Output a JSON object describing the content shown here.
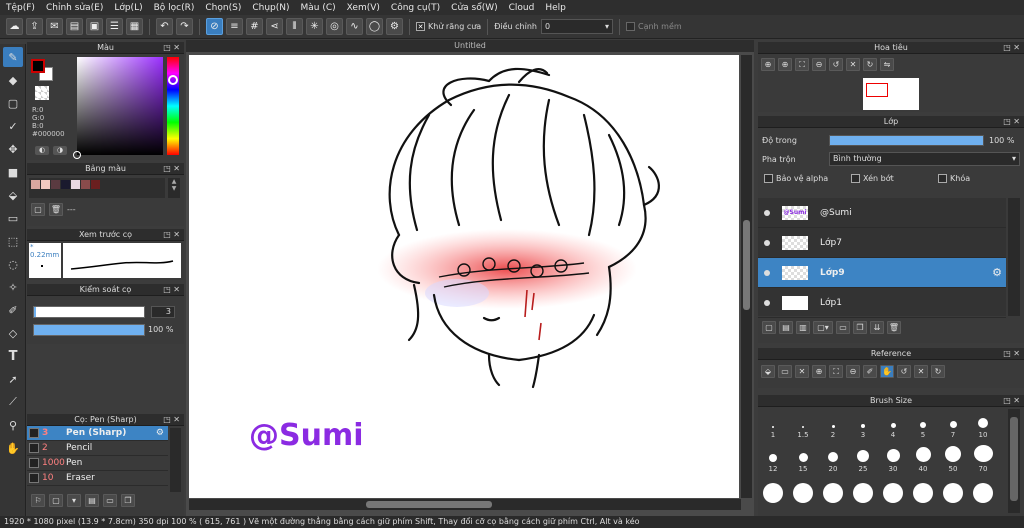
{
  "menu": [
    "Tệp(F)",
    "Chỉnh sửa(E)",
    "Lớp(L)",
    "Bộ lọc(R)",
    "Chọn(S)",
    "Chụp(N)",
    "Màu (C)",
    "Xem(V)",
    "Công cụ(T)",
    "Cửa sổ(W)",
    "Cloud",
    "Help"
  ],
  "toolbar": {
    "antialias_label": "Khử răng cưa",
    "antialias_checked": "✕",
    "adjust_label": "Điều chỉnh",
    "adjust_value": "0",
    "smooth_label": "Cạnh mềm"
  },
  "color_panel": {
    "title": "Màu",
    "r": "R:0",
    "g": "G:0",
    "b": "B:0",
    "hex": "#000000"
  },
  "palette_panel": {
    "title": "Bảng màu",
    "count": "---",
    "swatches": [
      "#d9a7a0",
      "#f0c9c0",
      "#5a3a40",
      "#1a1a2e",
      "#e8d8e0",
      "#8a4b4b",
      "#6b1f1f"
    ]
  },
  "brush_preview_panel": {
    "title": "Xem trước cọ",
    "size": "* 0.22mm"
  },
  "brush_control_panel": {
    "title": "Kiểm soát cọ",
    "size_value": "3",
    "opacity_value": "100 %",
    "size_fraction": 0.02,
    "opacity_fraction": 1.0
  },
  "brush_panel": {
    "title": "Cọ: Pen (Sharp)",
    "items": [
      {
        "size": "3",
        "name": "Pen (Sharp)"
      },
      {
        "size": "2",
        "name": "Pencil"
      },
      {
        "size": "1000",
        "name": "Pen"
      },
      {
        "size": "10",
        "name": "Eraser"
      }
    ]
  },
  "canvas": {
    "tab_title": "Untitled",
    "watermark": "@Sumi"
  },
  "navigator_panel": {
    "title": "Hoa tiêu"
  },
  "layer_panel": {
    "title": "Lớp",
    "opacity_label": "Độ trong",
    "opacity_value": "100 %",
    "opacity_fraction": 1.0,
    "blend_label": "Pha trộn",
    "blend_value": "Bình thường",
    "protect_alpha_label": "Bảo vệ alpha",
    "clipping_label": "Xén bớt",
    "lock_label": "Khóa",
    "layers": [
      {
        "name": "@Sumi",
        "thumb_text": "@Sumi"
      },
      {
        "name": "Lớp7",
        "thumb_text": ""
      },
      {
        "name": "Lớp9",
        "thumb_text": ""
      },
      {
        "name": "Lớp1",
        "thumb_text": ""
      }
    ]
  },
  "reference_panel": {
    "title": "Reference"
  },
  "brush_size_panel": {
    "title": "Brush Size",
    "row1": [
      "1",
      "1.5",
      "2",
      "3",
      "4",
      "5",
      "7",
      "10"
    ],
    "row2": [
      "12",
      "15",
      "20",
      "25",
      "30",
      "40",
      "50",
      "70"
    ]
  },
  "status": {
    "text": "1920 * 1080 pixel   (13.9 * 7.8cm)   350 dpi   100 %   ( 615, 761 )   Vẽ một đường thẳng bằng cách giữ phím Shift, Thay đổi cỡ cọ bằng cách giữ phím Ctrl, Alt và kéo"
  },
  "colors": {
    "accent": "#3d84c4",
    "watermark": "#8b2be2"
  }
}
